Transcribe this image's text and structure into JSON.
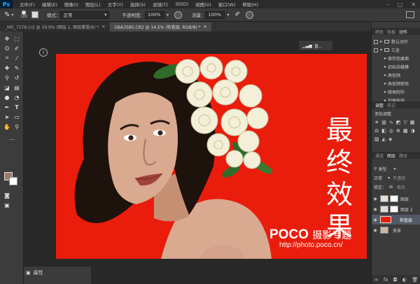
{
  "app": {
    "logo": "Ps"
  },
  "menu": [
    "文件(F)",
    "编辑(E)",
    "图像(I)",
    "图层(L)",
    "文字(Y)",
    "选择(S)",
    "滤镜(T)",
    "3D(D)",
    "视图(V)",
    "窗口(W)",
    "帮助(H)"
  ],
  "options": {
    "brush_size": "100",
    "mode_label": "模式：",
    "mode_value": "正常",
    "opacity_label": "不透明度：",
    "opacity_value": "100%",
    "flow_label": "流量：",
    "flow_value": "100%"
  },
  "tabs": [
    {
      "label": "_MG_7378.cr2 @ 19.9% (图层 1, 图层蒙版/8) *"
    },
    {
      "label": "GBA3585.CR2 @ 14.5% (检查层, RGB/8) *"
    }
  ],
  "canvas": {
    "title_chars": [
      "最",
      "终",
      "效",
      "果"
    ],
    "watermark_brand": "POCO",
    "watermark_subtitle": "摄影专题",
    "watermark_url": "http://photo.poco.cn/",
    "background_color": "#ea1c0c"
  },
  "actions_panel": {
    "tabs": [
      "颜色",
      "色板",
      "动作"
    ],
    "items": [
      "默认动作",
      "三金",
      "保存到桌面",
      "初始去缝模",
      "高低频",
      "高低频修饰",
      "暗角制作",
      "加强局部"
    ]
  },
  "adjustments_panel": {
    "tabs": [
      "调整",
      "样式"
    ],
    "title": "添加调整"
  },
  "layers_panel": {
    "tabs": [
      "通道",
      "图层",
      "路径"
    ],
    "kind_label": "类型",
    "blend_mode": "正常",
    "opacity_label": "不透明",
    "lock_label": "锁定：",
    "fill_label": "填充",
    "layers": [
      {
        "name": "图层",
        "thumb": "#e8dcd0",
        "selected": false
      },
      {
        "name": "图层 2",
        "thumb": "#ddd",
        "selected": false
      },
      {
        "name": "检查层",
        "thumb": "#ea1c0c",
        "selected": true
      },
      {
        "name": "背景",
        "thumb": "#c9b6a8",
        "selected": false
      }
    ]
  },
  "properties_panel": {
    "title": "属性"
  },
  "navigator_badge": "直...",
  "colors": {
    "accent": "#31a8ff",
    "foreground": "#9e7a66",
    "background": "#ffffff"
  }
}
